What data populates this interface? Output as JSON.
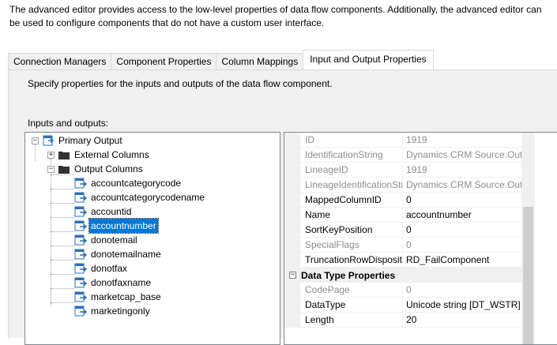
{
  "description": "The advanced editor provides access to the low-level properties of data flow components. Additionally, the advanced editor can be used to configure components that do not have a custom user interface.",
  "tabs": [
    {
      "label": "Connection Managers",
      "active": false
    },
    {
      "label": "Component Properties",
      "active": false
    },
    {
      "label": "Column Mappings",
      "active": false
    },
    {
      "label": "Input and Output Properties",
      "active": true
    }
  ],
  "instruction": "Specify properties for the inputs and outputs of the data flow component.",
  "inputs_outputs_label": "Inputs and outputs:",
  "tree": {
    "root": {
      "label": "Primary Output",
      "expander": "−"
    },
    "external": {
      "label": "External Columns",
      "expander": "+"
    },
    "output": {
      "label": "Output Columns",
      "expander": "−"
    },
    "columns": [
      "accountcategorycode",
      "accountcategorycodename",
      "accountid",
      "accountnumber",
      "donotemail",
      "donotemailname",
      "donotfax",
      "donotfaxname",
      "marketcap_base",
      "marketingonly"
    ],
    "selected": "accountnumber"
  },
  "properties": {
    "rows": [
      {
        "name": "ID",
        "value": "1919",
        "disabled": true
      },
      {
        "name": "IdentificationString",
        "value": "Dynamics CRM Source.Outp",
        "disabled": true
      },
      {
        "name": "LineageID",
        "value": "1919",
        "disabled": true
      },
      {
        "name": "LineageIdentificationStr",
        "value": "Dynamics CRM Source.Outp",
        "disabled": true
      },
      {
        "name": "MappedColumnID",
        "value": "0",
        "disabled": false
      },
      {
        "name": "Name",
        "value": "accountnumber",
        "disabled": false
      },
      {
        "name": "SortKeyPosition",
        "value": "0",
        "disabled": false
      },
      {
        "name": "SpecialFlags",
        "value": "0",
        "disabled": true
      },
      {
        "name": "TruncationRowDispositi",
        "value": "RD_FailComponent",
        "disabled": false
      }
    ],
    "category": {
      "label": "Data Type Properties",
      "expander": "−"
    },
    "category_rows": [
      {
        "name": "CodePage",
        "value": "0",
        "disabled": true
      },
      {
        "name": "DataType",
        "value": "Unicode string [DT_WSTR]",
        "disabled": false
      },
      {
        "name": "Length",
        "value": "20",
        "disabled": false
      }
    ]
  },
  "colors": {
    "selection": "#0078d7",
    "panel_bg": "#f0f0f0",
    "disabled_text": "#8d8d8d"
  }
}
